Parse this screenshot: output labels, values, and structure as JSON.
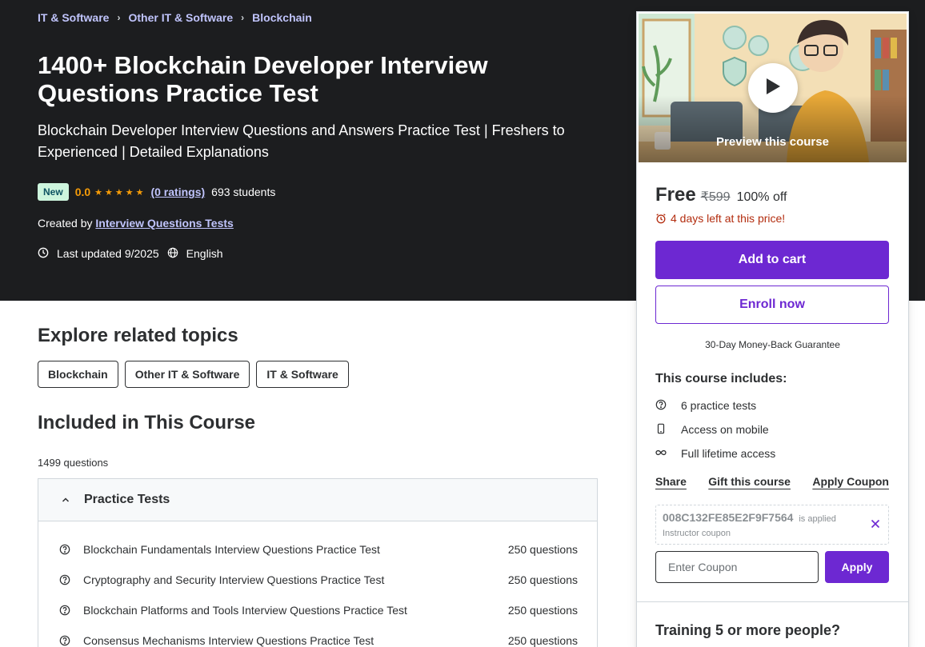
{
  "breadcrumb": [
    "IT & Software",
    "Other IT & Software",
    "Blockchain"
  ],
  "course": {
    "title": "1400+ Blockchain Developer Interview Questions Practice Test",
    "subtitle": "Blockchain Developer Interview Questions and Answers Practice Test | Freshers to Experienced | Detailed Explanations",
    "badge": "New",
    "rating": "0.0",
    "stars": "★★★★★",
    "rating_count": "(0 ratings)",
    "students": "693 students",
    "created_by_label": "Created by",
    "instructor": "Interview Questions Tests",
    "last_updated": "Last updated 9/2025",
    "language": "English"
  },
  "explore": {
    "title": "Explore related topics",
    "topics": [
      "Blockchain",
      "Other IT & Software",
      "IT & Software"
    ]
  },
  "included": {
    "title": "Included in This Course",
    "question_count": "1499 questions",
    "section_label": "Practice Tests",
    "tests": [
      {
        "name": "Blockchain Fundamentals Interview Questions Practice Test",
        "count": "250 questions"
      },
      {
        "name": "Cryptography and Security Interview Questions Practice Test",
        "count": "250 questions"
      },
      {
        "name": "Blockchain Platforms and Tools Interview Questions Practice Test",
        "count": "250 questions"
      },
      {
        "name": "Consensus Mechanisms Interview Questions Practice Test",
        "count": "250 questions"
      }
    ]
  },
  "sidebar": {
    "preview_label": "Preview this course",
    "price": "Free",
    "original_price": "₹599",
    "discount": "100% off",
    "timer": "4 days left at this price!",
    "add_to_cart": "Add to cart",
    "enroll": "Enroll now",
    "guarantee": "30-Day Money-Back Guarantee",
    "includes_title": "This course includes:",
    "includes": [
      "6 practice tests",
      "Access on mobile",
      "Full lifetime access"
    ],
    "links": {
      "share": "Share",
      "gift": "Gift this course",
      "apply_coupon": "Apply Coupon"
    },
    "coupon": {
      "code": "008C132FE85E2F9F7564",
      "applied": "is applied",
      "type": "Instructor coupon",
      "placeholder": "Enter Coupon",
      "apply": "Apply"
    },
    "training_title": "Training 5 or more people?"
  },
  "colors": {
    "hero_bg": "#1c1d1f",
    "link_purple": "#c0c4fc",
    "brand_purple": "#6d28d2",
    "star_orange": "#f69c08",
    "alert_red": "#b32d0f",
    "badge_green": "#cdf5dd"
  },
  "icons": [
    "chevron-right-icon",
    "clock-icon",
    "globe-icon",
    "question-circle-icon",
    "mobile-icon",
    "infinity-icon",
    "alarm-icon",
    "play-icon",
    "close-icon",
    "chevron-up-icon"
  ]
}
